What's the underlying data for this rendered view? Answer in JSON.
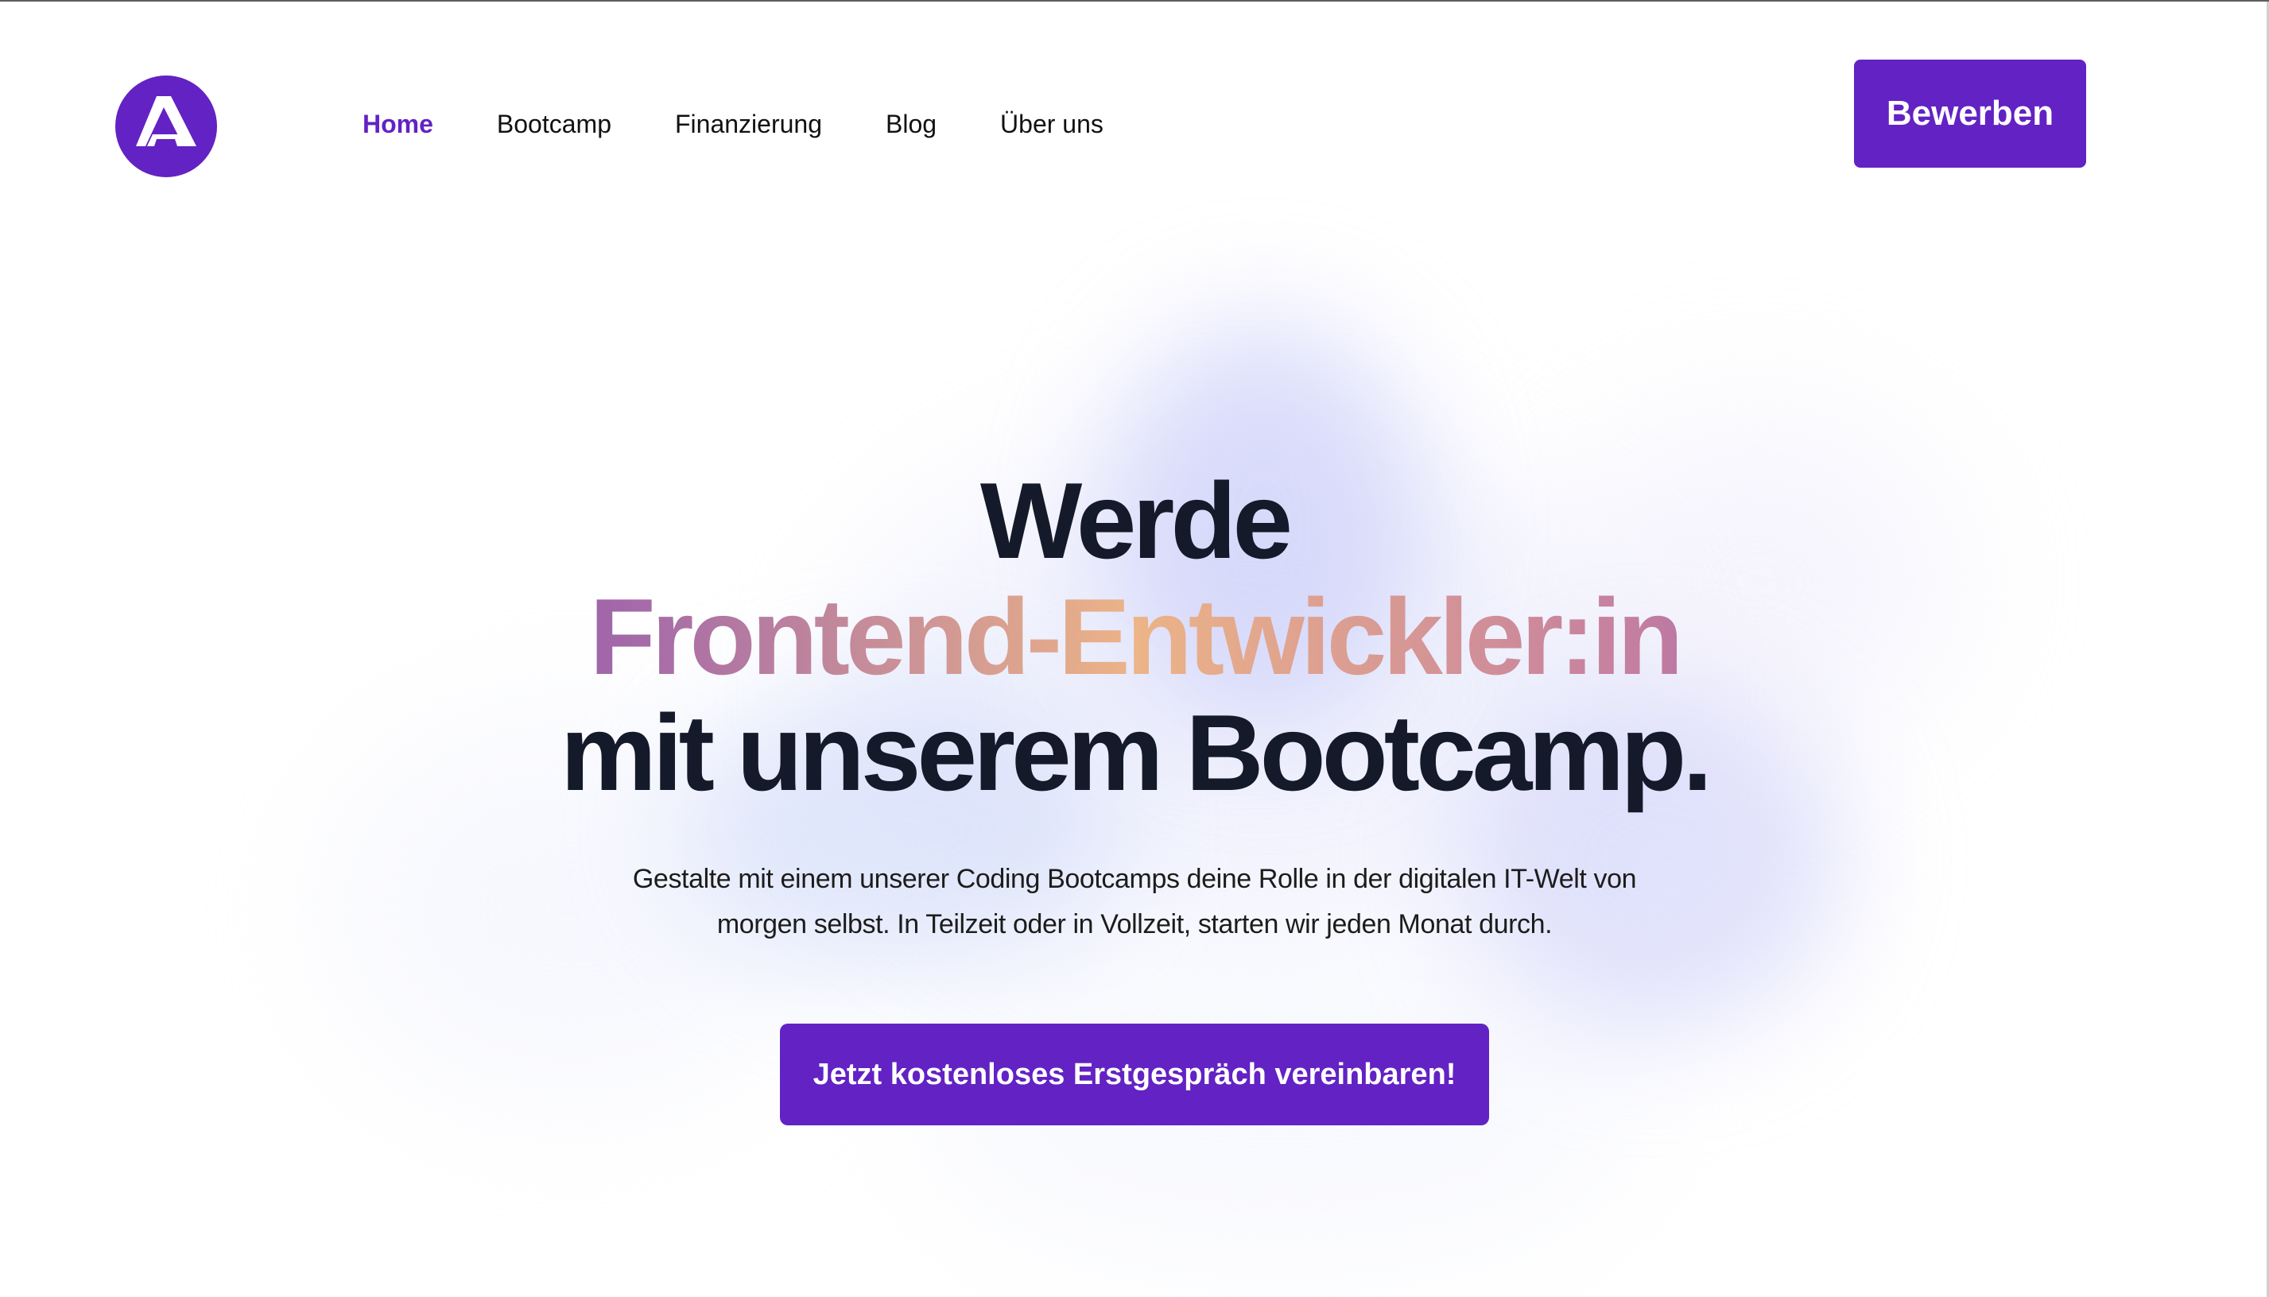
{
  "header": {
    "logo_icon": "peak-a-logo-icon",
    "nav": [
      {
        "label": "Home",
        "active": true
      },
      {
        "label": "Bootcamp",
        "active": false
      },
      {
        "label": "Finanzierung",
        "active": false
      },
      {
        "label": "Blog",
        "active": false
      },
      {
        "label": "Über uns",
        "active": false
      }
    ],
    "apply_label": "Bewerben"
  },
  "hero": {
    "title_line1": "Werde",
    "title_highlight": "Frontend-Entwickler:in",
    "title_line3": "mit unserem Bootcamp.",
    "subtitle": "Gestalte mit einem unserer Coding Bootcamps deine Rolle in der digitalen IT-Welt von morgen selbst. In Teilzeit oder in Vollzeit, starten wir jeden Monat durch.",
    "cta_label": "Jetzt kostenloses Erstgespräch vereinbaren!"
  },
  "colors": {
    "brand": "#6322c3",
    "heading": "#141a2a",
    "gradient_mid": "#ecb487"
  }
}
